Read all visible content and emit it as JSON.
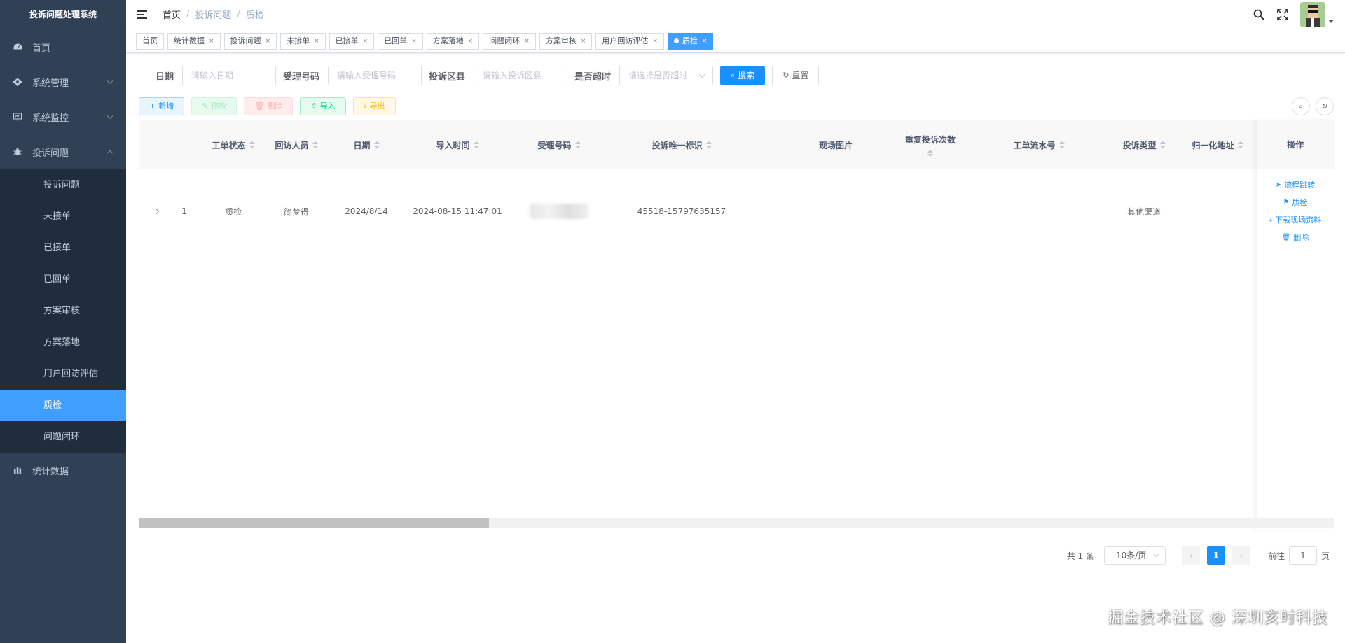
{
  "app_title": "投诉问题处理系统",
  "sidebar": {
    "items": [
      {
        "label": "首页",
        "icon": "dashboard-icon"
      },
      {
        "label": "系统管理",
        "icon": "gear-icon"
      },
      {
        "label": "系统监控",
        "icon": "monitor-icon"
      },
      {
        "label": "投诉问题",
        "icon": "bug-icon"
      },
      {
        "label": "统计数据",
        "icon": "bar-chart-icon"
      }
    ],
    "submenu": [
      {
        "label": "投诉问题"
      },
      {
        "label": "未接单"
      },
      {
        "label": "已接单"
      },
      {
        "label": "已回单"
      },
      {
        "label": "方案审核"
      },
      {
        "label": "方案落地"
      },
      {
        "label": "用户回访评估"
      },
      {
        "label": "质检",
        "active": true
      },
      {
        "label": "问题闭环"
      }
    ]
  },
  "breadcrumb": [
    "首页",
    "投诉问题",
    "质检"
  ],
  "tags": [
    "首页",
    "统计数据",
    "投诉问题",
    "未接单",
    "已接单",
    "已回单",
    "方案落地",
    "问题闭环",
    "方案审核",
    "用户回访评估",
    "质检"
  ],
  "search": {
    "date_label": "日期",
    "date_placeholder": "请输入日期",
    "acceptance_label": "受理号码",
    "acceptance_placeholder": "请输入受理号码",
    "district_label": "投诉区县",
    "district_placeholder": "请输入投诉区县",
    "overtime_label": "是否超时",
    "overtime_placeholder": "请选择是否超时",
    "search_button": "搜索",
    "reset_button": "重置"
  },
  "toolbar": {
    "add": "新增",
    "edit": "修改",
    "delete": "删除",
    "import": "导入",
    "export": "导出"
  },
  "table": {
    "columns": [
      "工单状态",
      "回访人员",
      "日期",
      "导入时间",
      "受理号码",
      "投诉唯一标识",
      "现场图片",
      "重复投诉次数",
      "工单流水号",
      "投诉类型",
      "归一化地址",
      "操作"
    ],
    "rows": [
      {
        "index": "1",
        "status": "质检",
        "visitor": "简梦得",
        "date": "2024/8/14",
        "import_time": "2024-08-15 11:47:01",
        "unique_id": "45518-15797635157",
        "complaint_type": "其他渠道"
      }
    ],
    "ops": [
      "流程跳转",
      "质检",
      "下载现场资料",
      "删除"
    ]
  },
  "pagination": {
    "total": "共 1 条",
    "page_size": "10条/页",
    "current": "1",
    "goto_label": "前往",
    "goto_value": "1",
    "page_suffix": "页"
  },
  "watermark": "掘金技术社区 @ 深圳亥时科技",
  "colors": {
    "sidebar_bg": "#304156",
    "submenu_bg": "#1f2d3d",
    "primary": "#1890ff",
    "active_menu": "#409eff"
  }
}
